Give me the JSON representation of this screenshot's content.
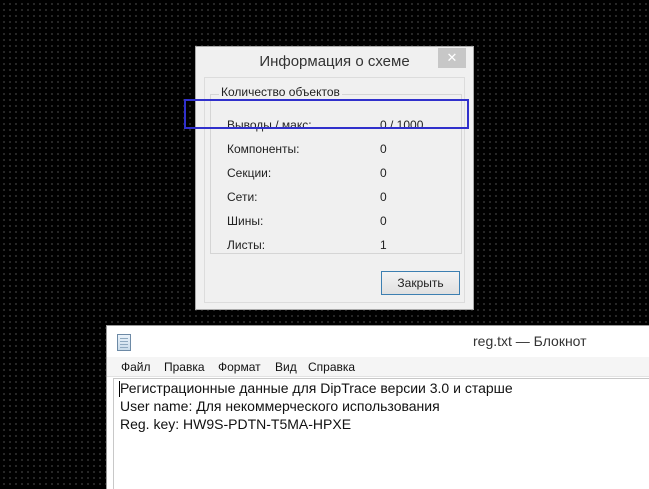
{
  "dialog": {
    "title": "Информация о схеме",
    "close_glyph": "✕",
    "group_title": "Количество объектов",
    "rows": [
      {
        "label": "Выводы / макс:",
        "value": "0 / 1000"
      },
      {
        "label": "Компоненты:",
        "value": "0"
      },
      {
        "label": "Секции:",
        "value": "0"
      },
      {
        "label": "Сети:",
        "value": "0"
      },
      {
        "label": "Шины:",
        "value": "0"
      },
      {
        "label": "Листы:",
        "value": "1"
      }
    ],
    "close_button": "Закрыть"
  },
  "highlight_color": "#3030cc",
  "notepad": {
    "title": "reg.txt — Блокнот",
    "menu": [
      "Файл",
      "Правка",
      "Формат",
      "Вид",
      "Справка"
    ],
    "lines": [
      "Регистрационные данные для DipTrace версии 3.0 и старше",
      "User name: Для некоммерческого использования",
      "Reg. key: HW9S-PDTN-T5MA-HPXE"
    ]
  }
}
